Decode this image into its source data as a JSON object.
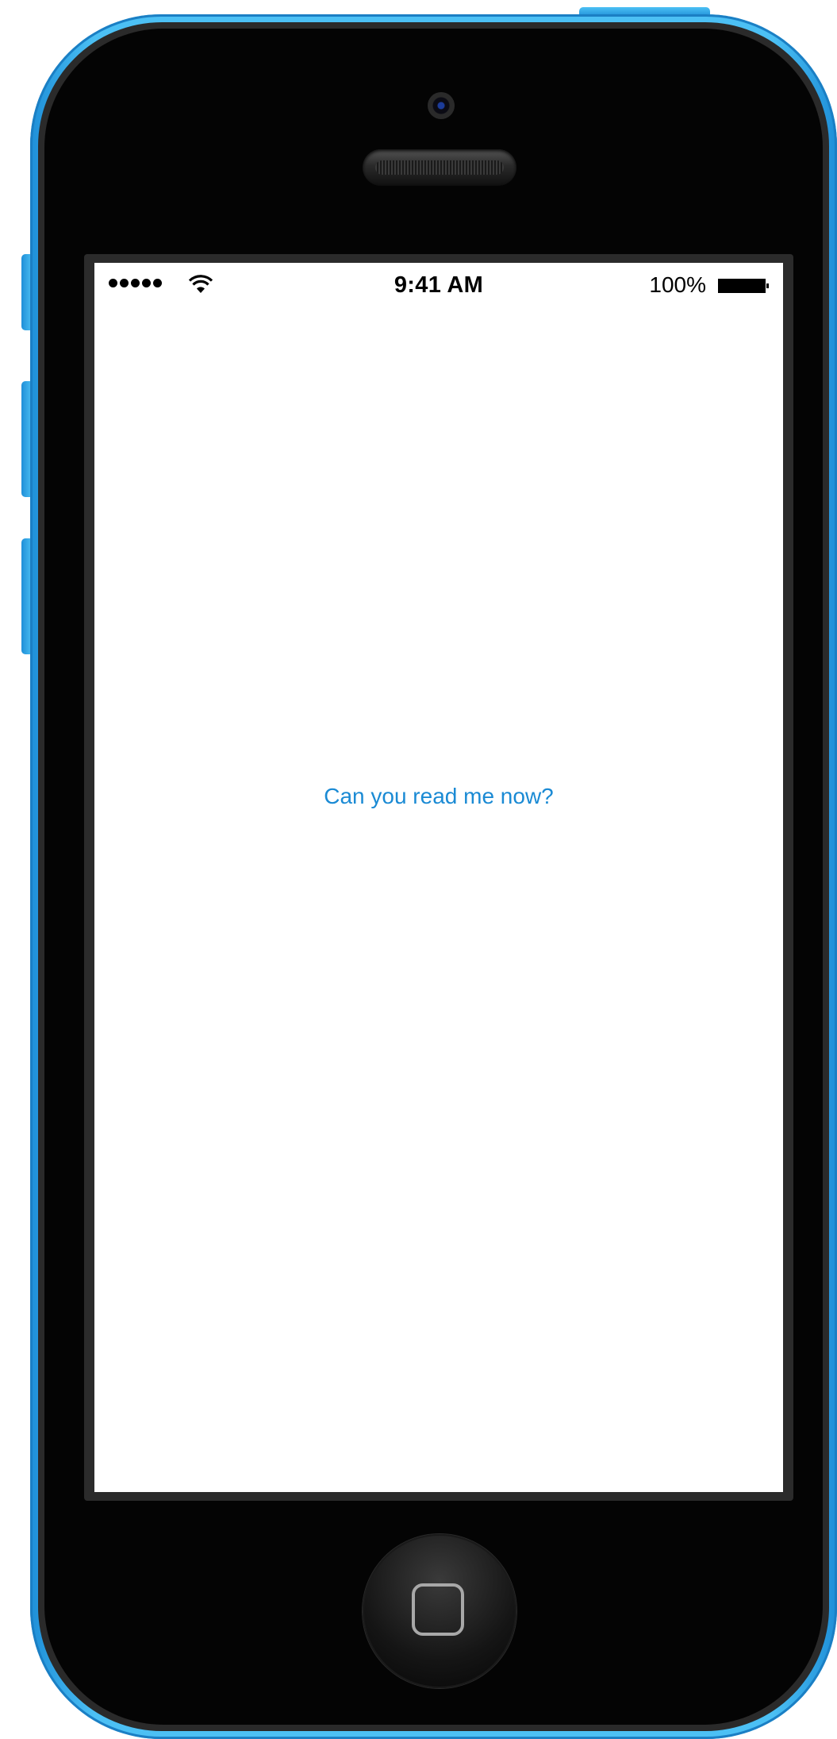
{
  "status_bar": {
    "signal_icon": "signal-dots-icon",
    "wifi_icon": "wifi-icon",
    "time": "9:41 AM",
    "battery_percent": "100%",
    "battery_icon": "battery-icon",
    "battery_level": 1.0
  },
  "main": {
    "message": "Can you read me now?"
  },
  "colors": {
    "device_shell": "#4cc0f4",
    "message_text": "#1a8ad4",
    "screen_background": "#ffffff"
  }
}
